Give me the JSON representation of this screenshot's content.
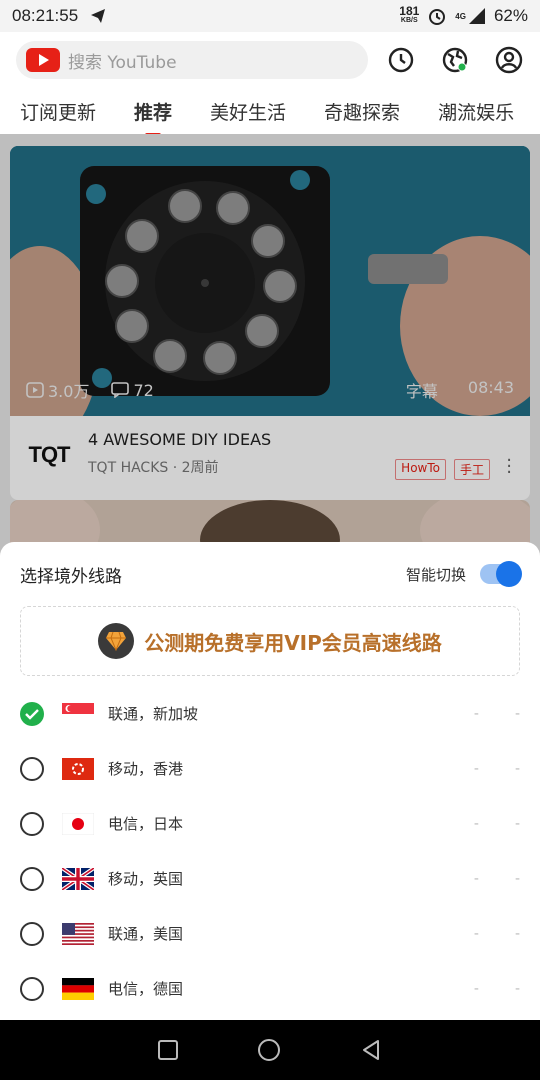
{
  "status_bar": {
    "time": "08:21:55",
    "net_speed_value": "181",
    "net_speed_unit": "KB/S",
    "network": "4G",
    "battery": "62%"
  },
  "header": {
    "search_placeholder": "搜索 YouTube"
  },
  "tabs": [
    "订阅更新",
    "推荐",
    "美好生活",
    "奇趣探索",
    "潮流娱乐"
  ],
  "active_tab": "推荐",
  "video": {
    "views": "3.0万",
    "comments": "72",
    "subtitle_label": "字幕",
    "duration": "08:43",
    "channel_logo_text": "TQT",
    "title": "4 AWESOME DIY IDEAS",
    "meta": "TQT HACKS · 2周前",
    "tags": [
      "HowTo",
      "手工"
    ]
  },
  "route_sheet": {
    "title": "选择境外线路",
    "smart_switch_label": "智能切换",
    "smart_switch_on": true,
    "vip_banner": "公测期免费享用VIP会员高速线路",
    "routes": [
      {
        "label": "联通，新加坡",
        "flag": "singapore-flag",
        "selected": true,
        "dash1": "-",
        "dash2": "-"
      },
      {
        "label": "移动，香港",
        "flag": "hongkong-flag",
        "selected": false,
        "dash1": "-",
        "dash2": "-"
      },
      {
        "label": "电信，日本",
        "flag": "japan-flag",
        "selected": false,
        "dash1": "-",
        "dash2": "-"
      },
      {
        "label": "移动，英国",
        "flag": "uk-flag",
        "selected": false,
        "dash1": "-",
        "dash2": "-"
      },
      {
        "label": "联通，美国",
        "flag": "usa-flag",
        "selected": false,
        "dash1": "-",
        "dash2": "-"
      },
      {
        "label": "电信，德国",
        "flag": "germany-flag",
        "selected": false,
        "dash1": "-",
        "dash2": "-"
      }
    ]
  },
  "colors": {
    "youtube_red": "#e62117",
    "toggle_blue": "#1a73e8",
    "check_green": "#21b04b",
    "vip_gold": "#b8702a"
  }
}
